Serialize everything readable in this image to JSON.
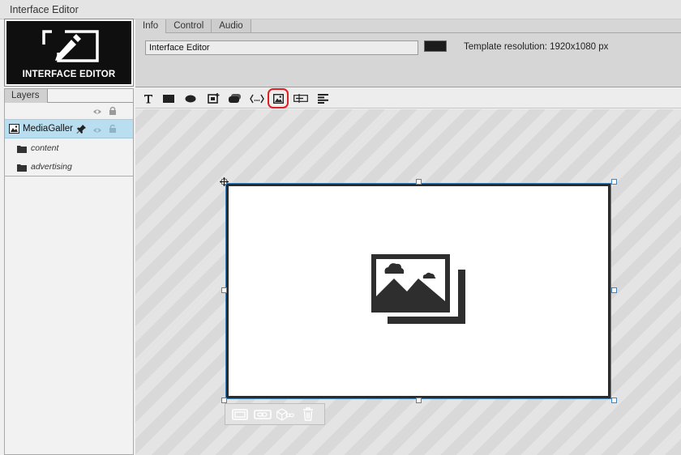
{
  "app": {
    "title": "Interface Editor"
  },
  "logo": {
    "text": "INTERFACE EDITOR",
    "icon": "pencil-in-screen-icon"
  },
  "header": {
    "tabs": [
      {
        "label": "Info",
        "active": true
      },
      {
        "label": "Control",
        "active": false
      },
      {
        "label": "Audio",
        "active": false
      }
    ],
    "name_value": "Interface Editor",
    "color_swatch": "#1c1c1c",
    "resolution_text": "Template resolution: 1920x1080 px"
  },
  "toolbar": {
    "tools": [
      {
        "icon": "text-tool-icon"
      },
      {
        "icon": "rectangle-tool-icon"
      },
      {
        "icon": "ellipse-tool-icon"
      },
      {
        "icon": "add-frame-tool-icon"
      },
      {
        "icon": "layers-tool-icon"
      },
      {
        "icon": "code-tool-icon"
      },
      {
        "icon": "media-gallery-tool-icon",
        "highlighted": true
      },
      {
        "icon": "ticker-tool-icon"
      },
      {
        "icon": "align-tool-icon"
      }
    ],
    "highlight_color": "#e02020"
  },
  "layers": {
    "tab_label": "Layers",
    "items": [
      {
        "label": "MediaGaller",
        "selected": true,
        "icon": "image-icon"
      },
      {
        "label": "content",
        "icon": "folder-icon"
      },
      {
        "label": "advertising",
        "icon": "folder-icon"
      }
    ],
    "selected_color": "#b9def0"
  },
  "canvas": {
    "widget_icon": "media-gallery-placeholder-icon",
    "widget_tools": [
      {
        "icon": "frame-icon"
      },
      {
        "icon": "link-icon"
      },
      {
        "icon": "3d-link-icon"
      },
      {
        "icon": "trash-icon"
      }
    ]
  }
}
